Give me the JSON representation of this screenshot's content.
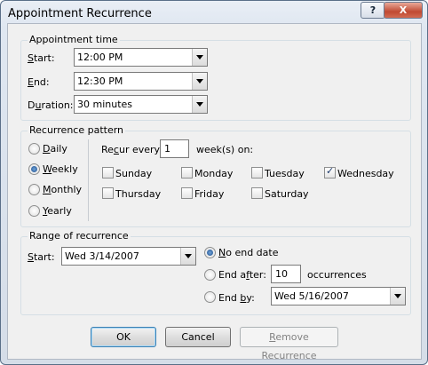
{
  "window": {
    "title": "Appointment Recurrence",
    "help_label": "?",
    "close_label": "X"
  },
  "appointment_time": {
    "group_label": "Appointment time",
    "start": {
      "label_u": "S",
      "label_rest": "tart:",
      "value": "12:00 PM"
    },
    "end": {
      "label_u": "E",
      "label_rest": "nd:",
      "value": "12:30 PM"
    },
    "duration": {
      "label_pre": "D",
      "label_u": "u",
      "label_rest": "ration:",
      "value": "30 minutes"
    }
  },
  "recurrence_pattern": {
    "group_label": "Recurrence pattern",
    "options": {
      "daily": {
        "label_u": "D",
        "label_rest": "aily"
      },
      "weekly": {
        "label_u": "W",
        "label_rest": "eekly"
      },
      "monthly": {
        "label_u": "M",
        "label_rest": "onthly"
      },
      "yearly": {
        "label_u": "Y",
        "label_rest": "early"
      }
    },
    "selected": "Weekly",
    "recur_pre": "Re",
    "recur_u": "c",
    "recur_post": "ur every",
    "recur_value": "1",
    "weeks_on": "week(s) on:",
    "days": {
      "sunday": {
        "label": "Sunday",
        "checked": false
      },
      "monday": {
        "label": "Monday",
        "checked": false
      },
      "tuesday": {
        "label": "Tuesday",
        "checked": false
      },
      "wednesday": {
        "label": "Wednesday",
        "checked": true
      },
      "thursday": {
        "label": "Thursday",
        "checked": false
      },
      "friday": {
        "label": "Friday",
        "checked": false
      },
      "saturday": {
        "label": "Saturday",
        "checked": false
      }
    }
  },
  "range": {
    "group_label": "Range of recurrence",
    "start": {
      "label_u": "S",
      "label_rest": "tart:",
      "value": "Wed 3/14/2007"
    },
    "no_end": {
      "label_pre": "N",
      "label_u": "o",
      "label_rest": " end date"
    },
    "end_after": {
      "label_pre": "End a",
      "label_u": "f",
      "label_rest": "ter:",
      "value": "10",
      "suffix": "occurrences"
    },
    "end_by": {
      "label_pre": "End ",
      "label_u": "b",
      "label_rest": "y:",
      "value": "Wed 5/16/2007"
    },
    "selected": "No end date"
  },
  "buttons": {
    "ok": "OK",
    "cancel": "Cancel",
    "remove_u": "R",
    "remove_rest": "emove Recurrence"
  }
}
